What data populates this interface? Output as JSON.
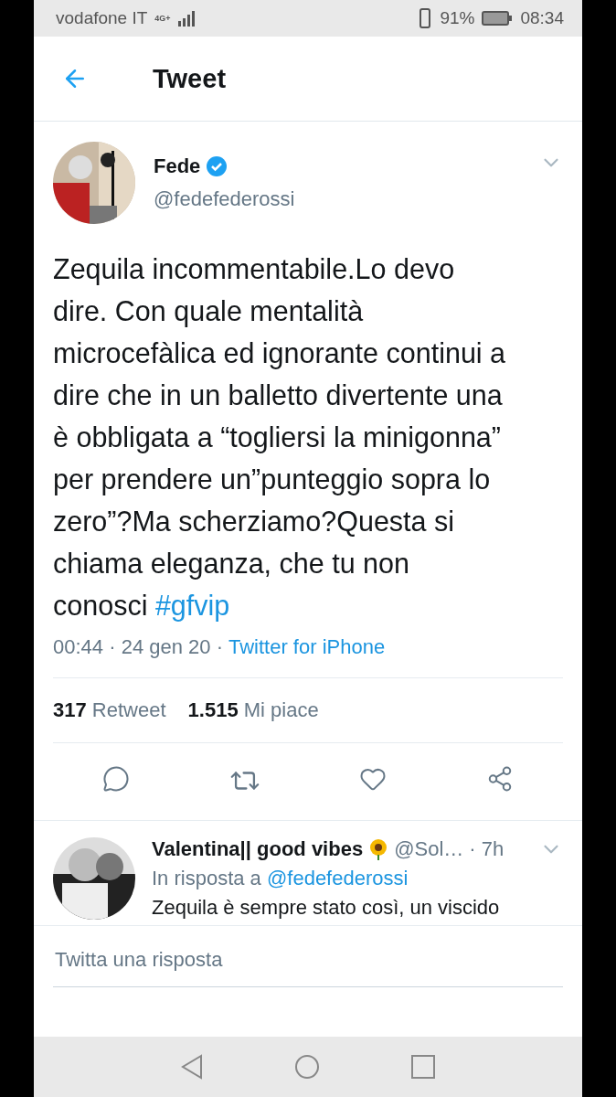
{
  "status_bar": {
    "carrier": "vodafone IT",
    "network": "4G+",
    "battery": "91%",
    "time": "08:34"
  },
  "header": {
    "title": "Tweet"
  },
  "tweet": {
    "name": "Fede",
    "verified": true,
    "handle": "@fedefederossi",
    "text": "Zequila incommentabile.Lo devo dire. Con quale mentalità microcefàlica ed ignorante continui a dire che in un balletto divertente una è obbligata a “togliersi la minigonna” per prendere un”punteggio sopra lo zero”?Ma scherziamo?Questa si chiama eleganza, che tu non conosci",
    "hashtag": "#gfvip",
    "separator": "·",
    "time": "00:44",
    "date": "24 gen 20",
    "source": "Twitter for iPhone",
    "retweets": "317",
    "retweets_label": "Retweet",
    "likes": "1.515",
    "likes_label": "Mi piace"
  },
  "reply": {
    "name": "Valentina|| good vibes",
    "handle": "@Sol…",
    "age": "· 7h",
    "in_reply_label": "In risposta a",
    "in_reply_to": "@fedefederossi",
    "text": "Zequila è sempre stato così, un viscido"
  },
  "composer": {
    "placeholder": "Twitta una risposta"
  }
}
